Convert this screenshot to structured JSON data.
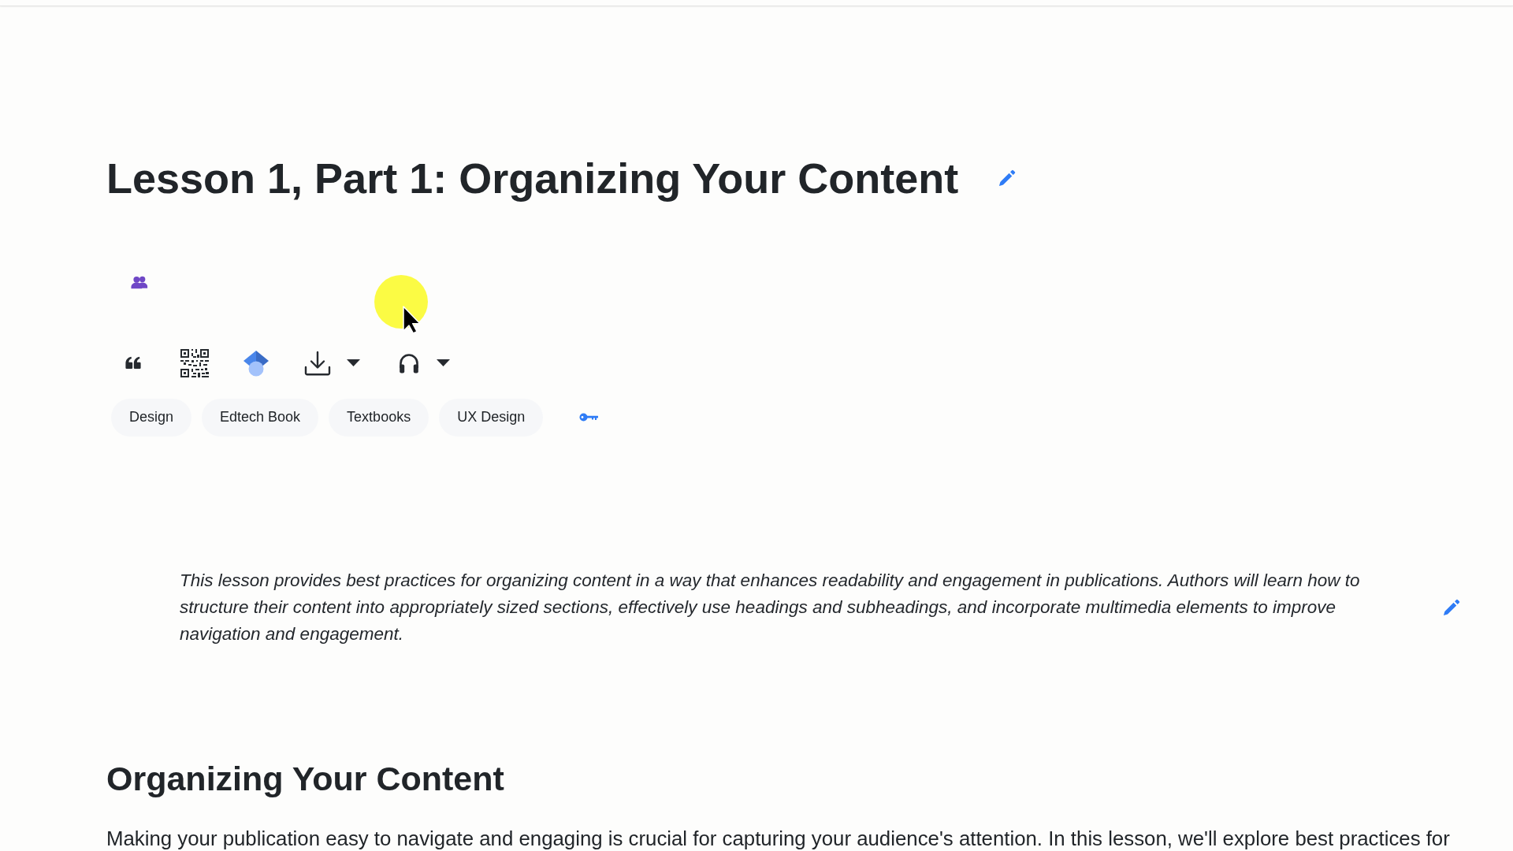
{
  "title": "Lesson 1, Part 1: Organizing Your Content",
  "tags": [
    "Design",
    "Edtech Book",
    "Textbooks",
    "UX Design"
  ],
  "summary": "This lesson provides best practices for organizing content in a way that enhances readability and engagement in publications. Authors will learn how to structure their content into appropriately sized sections, effectively use headings and subheadings, and incorporate multimedia elements to improve navigation and engagement.",
  "section": {
    "heading": "Organizing Your Content",
    "text": "Making your publication easy to navigate and engaging is crucial for capturing your audience's attention. In this lesson, we'll explore best practices for"
  }
}
